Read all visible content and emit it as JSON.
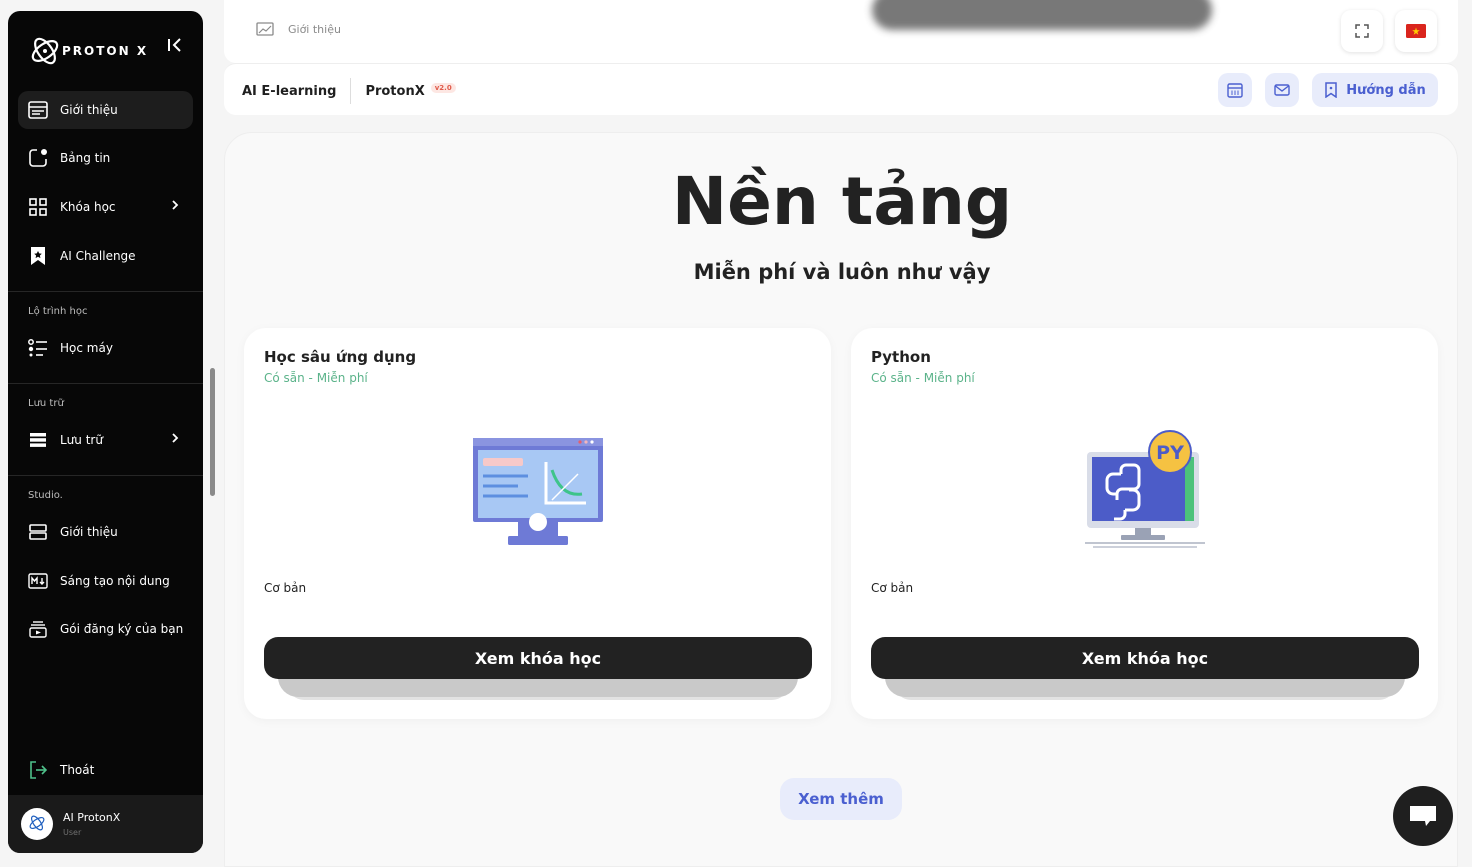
{
  "sidebar": {
    "logo_text": "PROTON X",
    "main_items": [
      {
        "label": "Giới thiệu",
        "icon": "intro-icon"
      },
      {
        "label": "Bảng tin",
        "icon": "newsfeed-icon"
      },
      {
        "label": "Khóa học",
        "icon": "courses-icon"
      },
      {
        "label": "AI Challenge",
        "icon": "bookmark-star-icon"
      }
    ],
    "section_roadmap": "Lộ trình học",
    "roadmap_item": "Học máy",
    "section_storage": "Lưu trữ",
    "storage_item": "Lưu trữ",
    "section_studio": "Studio.",
    "studio_items": [
      {
        "label": "Giới thiệu"
      },
      {
        "label": "Sáng tạo nội dung"
      },
      {
        "label": "Gói đăng ký của bạn"
      }
    ],
    "logout": "Thoát",
    "user": {
      "name": "AI ProtonX",
      "role": "User"
    }
  },
  "topbar": {
    "breadcrumb": "Giới thiệu"
  },
  "subbar": {
    "app": "AI E-learning",
    "brand": "ProtonX",
    "version": "v2.0",
    "guide": "Hướng dẫn"
  },
  "hero": {
    "title": "Nền tảng",
    "subtitle": "Miễn phí và luôn như vậy"
  },
  "cards": [
    {
      "title": "Học sâu ứng dụng",
      "availability": "Có sẵn - Miễn phí",
      "level": "Cơ bản",
      "button": "Xem khóa học"
    },
    {
      "title": "Python",
      "availability": "Có sẵn - Miễn phí",
      "level": "Cơ bản",
      "button": "Xem khóa học",
      "badge": "PY"
    }
  ],
  "more_button": "Xem thêm",
  "colors": {
    "accent": "#4a5fd0",
    "accent_bg": "#e8ecfb",
    "available": "#5bb38a",
    "sidebar": "#070707"
  }
}
